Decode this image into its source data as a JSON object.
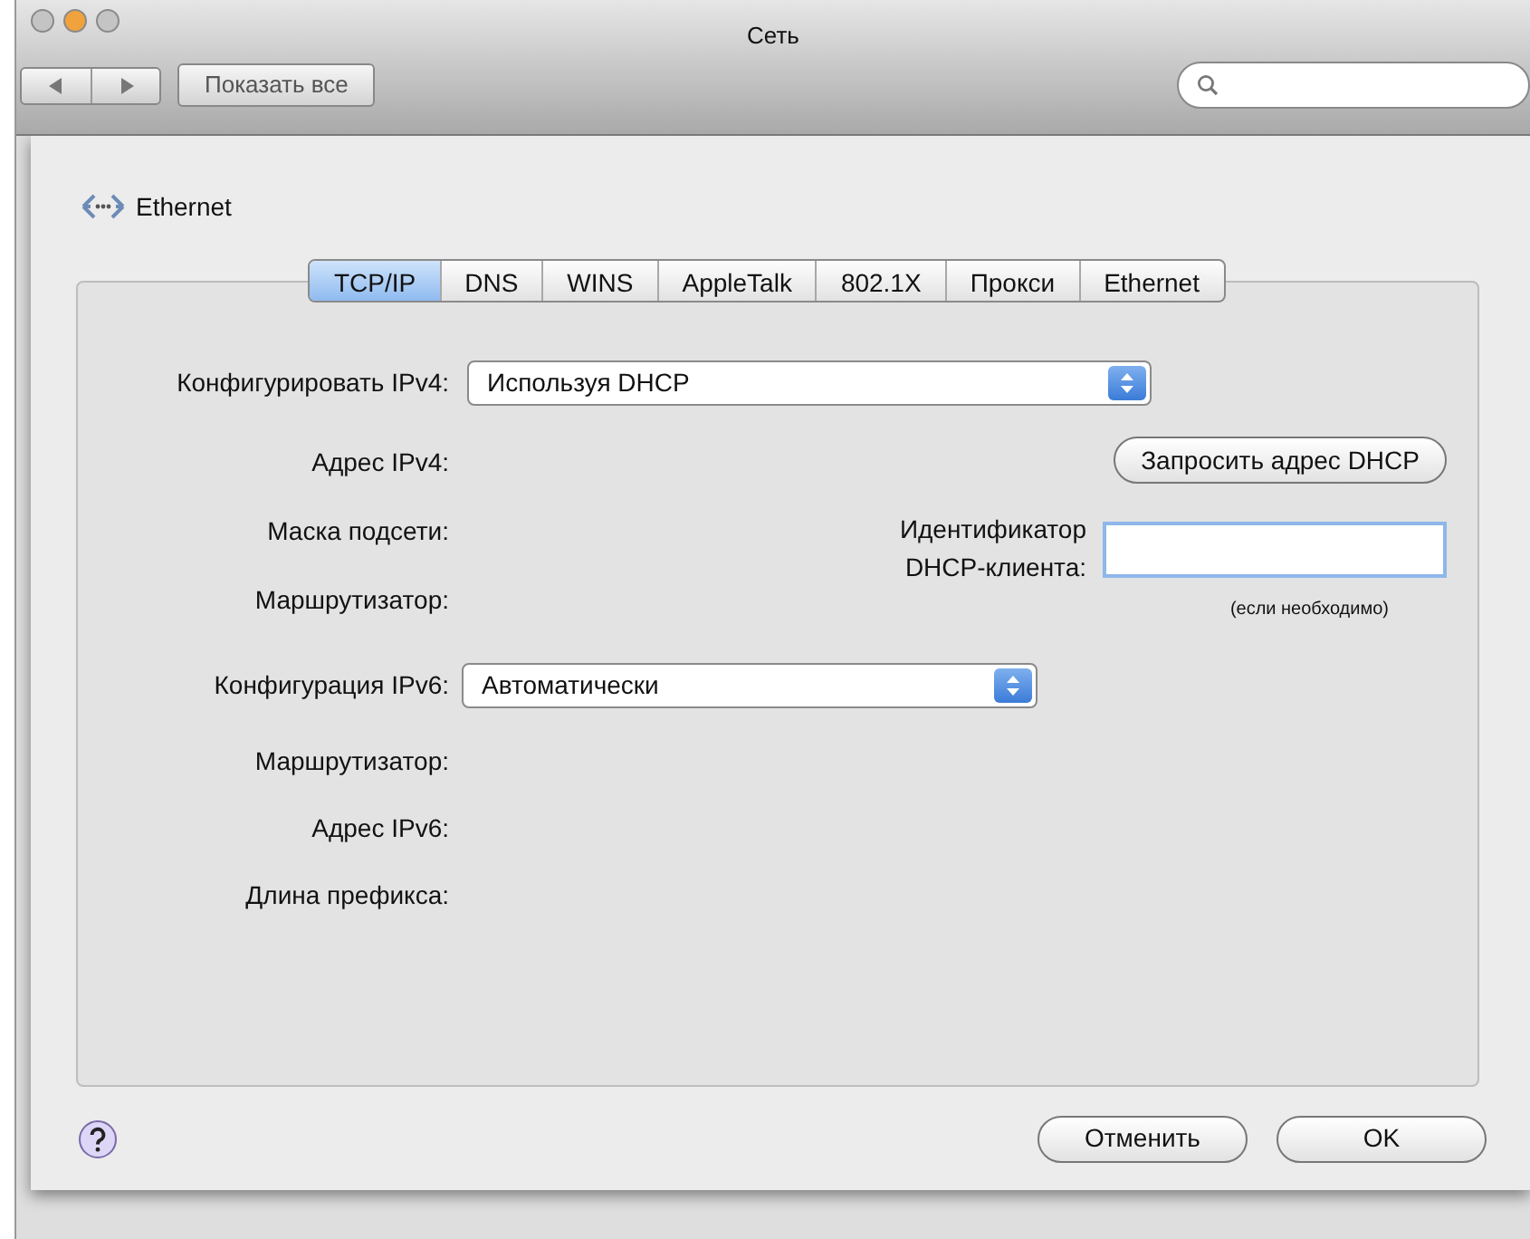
{
  "window": {
    "title": "Сеть",
    "traffic_lights": [
      {
        "color": "#c4c4c4"
      },
      {
        "color": "#f0a23c"
      },
      {
        "color": "#c4c4c4"
      }
    ]
  },
  "toolbar": {
    "show_all_button": "Показать все"
  },
  "service": {
    "name": "Ethernet"
  },
  "tabs": [
    {
      "label": "TCP/IP",
      "selected": true
    },
    {
      "label": "DNS",
      "selected": false
    },
    {
      "label": "WINS",
      "selected": false
    },
    {
      "label": "AppleTalk",
      "selected": false
    },
    {
      "label": "802.1X",
      "selected": false
    },
    {
      "label": "Прокси",
      "selected": false
    },
    {
      "label": "Ethernet",
      "selected": false
    }
  ],
  "ipv4": {
    "label": "Конфигурировать IPv4:",
    "value": "Используя DHCP",
    "fields": [
      "Адрес IPv4:",
      "Маска подсети:",
      "Маршрутизатор:"
    ]
  },
  "renew_button": "Запросить адрес DHCP",
  "dhcp_client_id": {
    "label": "Идентификатор\nDHCP-клиента:",
    "hint": "(если необходимо)"
  },
  "ipv6": {
    "label": "Конфигурация IPv6:",
    "value": "Автоматически",
    "fields": [
      "Маршрутизатор:",
      "Адрес IPv6:",
      "Длина префикса:"
    ]
  },
  "buttons": [
    {
      "label": "Отменить"
    },
    {
      "label": "OK"
    }
  ]
}
